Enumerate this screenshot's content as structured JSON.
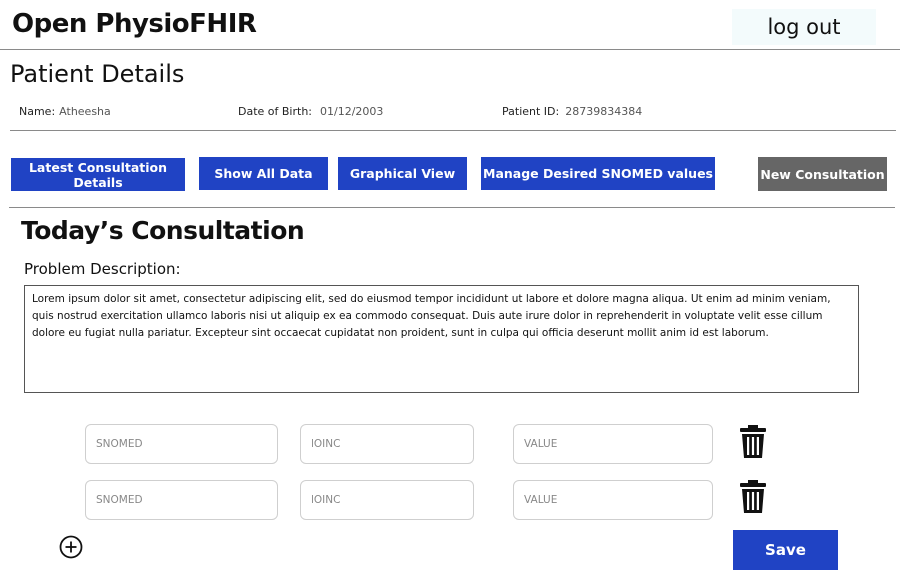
{
  "header": {
    "app_title": "Open PhysioFHIR",
    "logout_label": "log out"
  },
  "patient": {
    "section_title": "Patient Details",
    "name_label": "Name:",
    "name_value": "Atheesha",
    "dob_label": "Date of Birth:",
    "dob_value": "01/12/2003",
    "id_label": "Patient ID:",
    "id_value": "28739834384"
  },
  "nav": {
    "latest": "Latest Consultation Details",
    "show_all": "Show All Data",
    "graphical": "Graphical View",
    "manage": "Manage Desired SNOMED values",
    "new_consult": "New Consultation"
  },
  "consultation": {
    "title": "Today’s Consultation",
    "problem_label": "Problem Description:",
    "problem_text": "Lorem ipsum dolor sit amet, consectetur adipiscing elit, sed do eiusmod tempor incididunt ut labore et dolore magna aliqua. Ut enim ad minim veniam, quis nostrud exercitation ullamco laboris nisi ut aliquip ex ea commodo consequat. Duis aute irure dolor in reprehenderit in voluptate velit esse cillum dolore eu fugiat nulla pariatur. Excepteur sint occaecat cupidatat non proident, sunt in culpa qui officia deserunt mollit anim id est laborum.",
    "rows": [
      {
        "snomed": "SNOMED",
        "loinc": "lOINC",
        "value": "VALUE"
      },
      {
        "snomed": "SNOMED",
        "loinc": "lOINC",
        "value": "VALUE"
      }
    ],
    "save_label": "Save"
  },
  "colors": {
    "primary": "#2043c4",
    "secondary": "#666666",
    "logout_bg": "#f3fbfc"
  },
  "icons": [
    "trash-icon",
    "add-circle-icon"
  ]
}
